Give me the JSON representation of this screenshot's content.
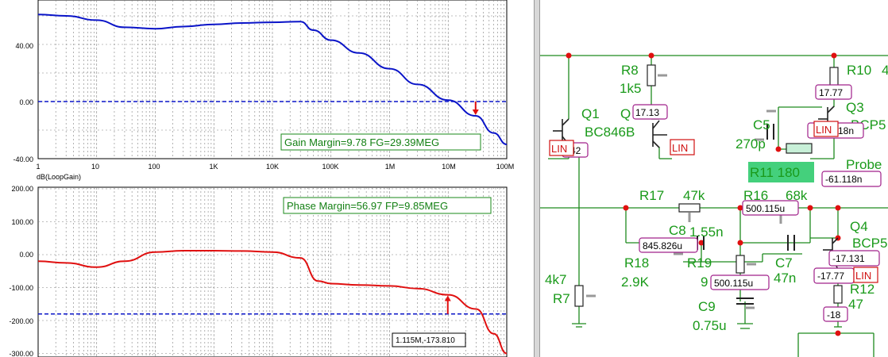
{
  "top_plot": {
    "y_ticks": [
      "40.00",
      "0.00",
      "-40.00"
    ],
    "x_ticks": [
      "1",
      "10",
      "100",
      "1K",
      "10K",
      "100K",
      "1M",
      "10M",
      "100M"
    ],
    "axis_label": "dB(LoopGain)",
    "annotation": "Gain Margin=9.78 FG=29.39MEG",
    "colors": {
      "curve": "#0a14c8",
      "reference": "#0a14c8",
      "marker": "#e01010",
      "grid": "#808080"
    }
  },
  "bottom_plot": {
    "y_ticks": [
      "200.00",
      "100.00",
      "0.00",
      "-100.00",
      "-200.00",
      "-300.00"
    ],
    "annotation": "Phase Margin=56.97 FP=9.85MEG",
    "cursor_readout": "1.115M,-173.810",
    "colors": {
      "curve": "#e01010",
      "reference": "#0a14c8",
      "marker": "#e01010"
    }
  },
  "chart_data": [
    {
      "type": "line",
      "x_scale": "log",
      "xlim": [
        1,
        100000000
      ],
      "ylim": [
        -40,
        65
      ],
      "xlabel": "dB(LoopGain)",
      "x_ticks": [
        "1",
        "10",
        "100",
        "1K",
        "10K",
        "100K",
        "1M",
        "10M",
        "100M"
      ],
      "y_ticks": [
        40,
        0,
        -40
      ],
      "series": [
        {
          "x": [
            1,
            3,
            10,
            30,
            100,
            300,
            1000,
            3000,
            10000,
            30000,
            50000,
            100000,
            300000,
            1000000,
            3000000,
            10000000,
            29390000,
            60000000,
            100000000
          ],
          "y": [
            61,
            60,
            57,
            52,
            51,
            52.5,
            54,
            55,
            55.5,
            56,
            50,
            43,
            34,
            23,
            12,
            1,
            -10,
            -22,
            -30
          ]
        }
      ],
      "reference_y": 0,
      "marker_x": 29390000,
      "annotation": "Gain Margin=9.78 FG=29.39MEG"
    },
    {
      "type": "line",
      "x_scale": "log",
      "xlim": [
        1,
        100000000
      ],
      "ylim": [
        -300,
        200
      ],
      "y_ticks": [
        200,
        100,
        0,
        -100,
        -200,
        -300
      ],
      "series": [
        {
          "x": [
            1,
            3,
            10,
            30,
            100,
            300,
            1000,
            3000,
            10000,
            30000,
            60000,
            100000,
            300000,
            1000000,
            3000000,
            10000000,
            30000000,
            60000000,
            100000000
          ],
          "y": [
            -20,
            -25,
            -38,
            -20,
            8,
            12,
            12,
            11,
            8,
            -10,
            -80,
            -88,
            -92,
            -95,
            -103,
            -122,
            -165,
            -240,
            -300
          ]
        }
      ],
      "reference_y": -180,
      "marker_x": 9850000,
      "annotation": "Phase Margin=56.97 FP=9.85MEG",
      "cursor_readout": "1.115M,-173.810"
    }
  ],
  "schematic": {
    "colors": {
      "wire": "#1e8a1e",
      "label": "#1a9a1a",
      "node": "#e01010",
      "value_border": "#a0208a",
      "highlight": "#44d07c"
    },
    "labels": {
      "r8": "R8",
      "r8_val": "1k5",
      "q1": "Q1",
      "q1_type": "BC846B",
      "q2_partial": "Q",
      "r10": "R10",
      "r10_partial": "4",
      "q3": "Q3",
      "q3_type": "BCP5",
      "c5": "C5",
      "c5_val": "270p",
      "r11": "R11 180",
      "probe": "Probe",
      "r17": "R17",
      "r17_val": "47k",
      "r16": "R16",
      "r16_val": "68k",
      "c8": "C8",
      "c8_val": "1.55n",
      "r18": "R18",
      "r18_val": "2.9K",
      "r19": "R19",
      "r19_val": "9",
      "c7": "C7",
      "c7_val": "47n",
      "q4": "Q4",
      "q4_type": "BCP5",
      "r7_val": "4k7",
      "r7": "R7",
      "c9": "C9",
      "c9_val": "0.75u",
      "r12": "R12",
      "r12_val": "47"
    },
    "values": {
      "v1": "42",
      "v2": "17.13",
      "v3": "17.77",
      "v4": "18n",
      "v5": "-61.118n",
      "v6": "500.115u",
      "v7": "845.826u",
      "v8": "500.115u",
      "v9": "-17.131",
      "v10": "-17.77",
      "v11": "-18"
    },
    "lin_tag": "LIN"
  }
}
